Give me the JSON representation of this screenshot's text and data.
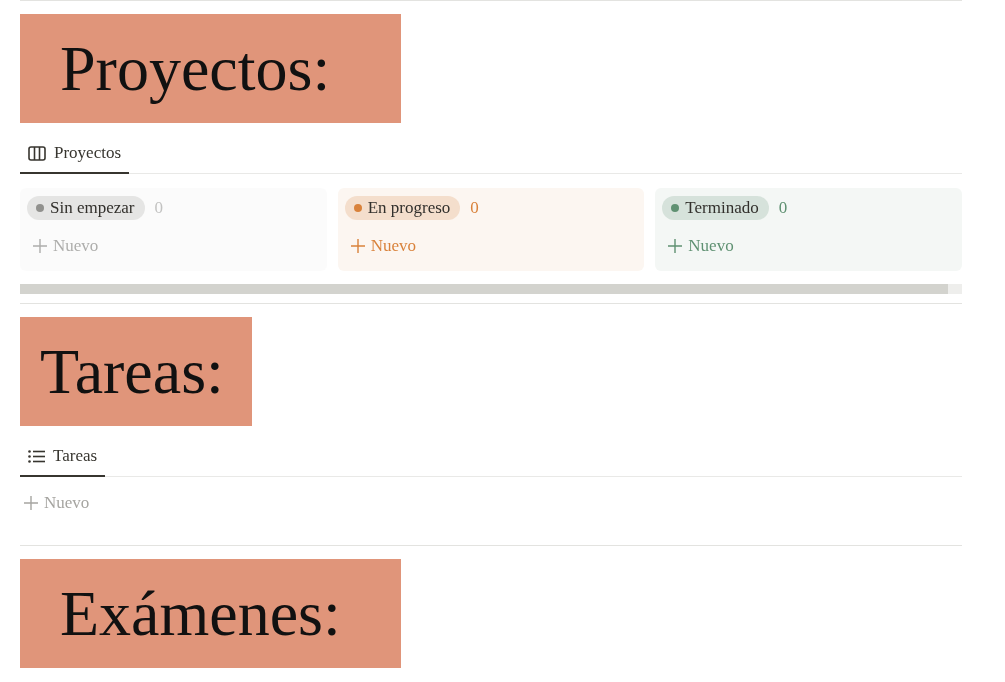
{
  "sections": [
    {
      "kind": "board",
      "heading": "Proyectos:",
      "tabs": [
        {
          "label": "Proyectos",
          "selected": true
        }
      ],
      "groups": [
        {
          "label": "Sin empezar",
          "count": "0",
          "color": "#91918e",
          "add": "Nuevo"
        },
        {
          "label": "En progreso",
          "count": "0",
          "color": "#d9823b",
          "add": "Nuevo"
        },
        {
          "label": "Terminado",
          "count": "0",
          "color": "#5f9172",
          "add": "Nuevo"
        }
      ]
    },
    {
      "kind": "list",
      "heading": "Tareas:",
      "tabs": [
        {
          "label": "Tareas",
          "selected": true
        }
      ],
      "add": "Nuevo"
    },
    {
      "kind": "heading",
      "heading": "Exámenes:"
    }
  ]
}
